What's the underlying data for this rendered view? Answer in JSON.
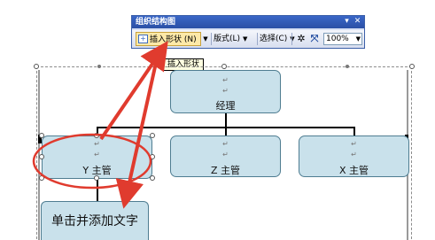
{
  "toolbar": {
    "title": "组织结构图",
    "insert_shape": "插入形状",
    "insert_shape_key": "(N)",
    "layout": "版式",
    "layout_key": "(L)",
    "select": "选择",
    "select_key": "(C)",
    "zoom": "100%",
    "colors": {
      "title_bar": "#2f58b3",
      "active_button": "#fde9a8"
    }
  },
  "tooltip": "插入形状",
  "org_chart": {
    "top": {
      "label": "经理"
    },
    "subordinates": [
      {
        "label": "Y 主管"
      },
      {
        "label": "Z 主管"
      },
      {
        "label": "X 主管"
      }
    ],
    "new_box_placeholder": "单击并添加文字",
    "paragraph_mark": "↵",
    "box_color": "#c9e1eb"
  },
  "annotation_color": "#e03b2e"
}
